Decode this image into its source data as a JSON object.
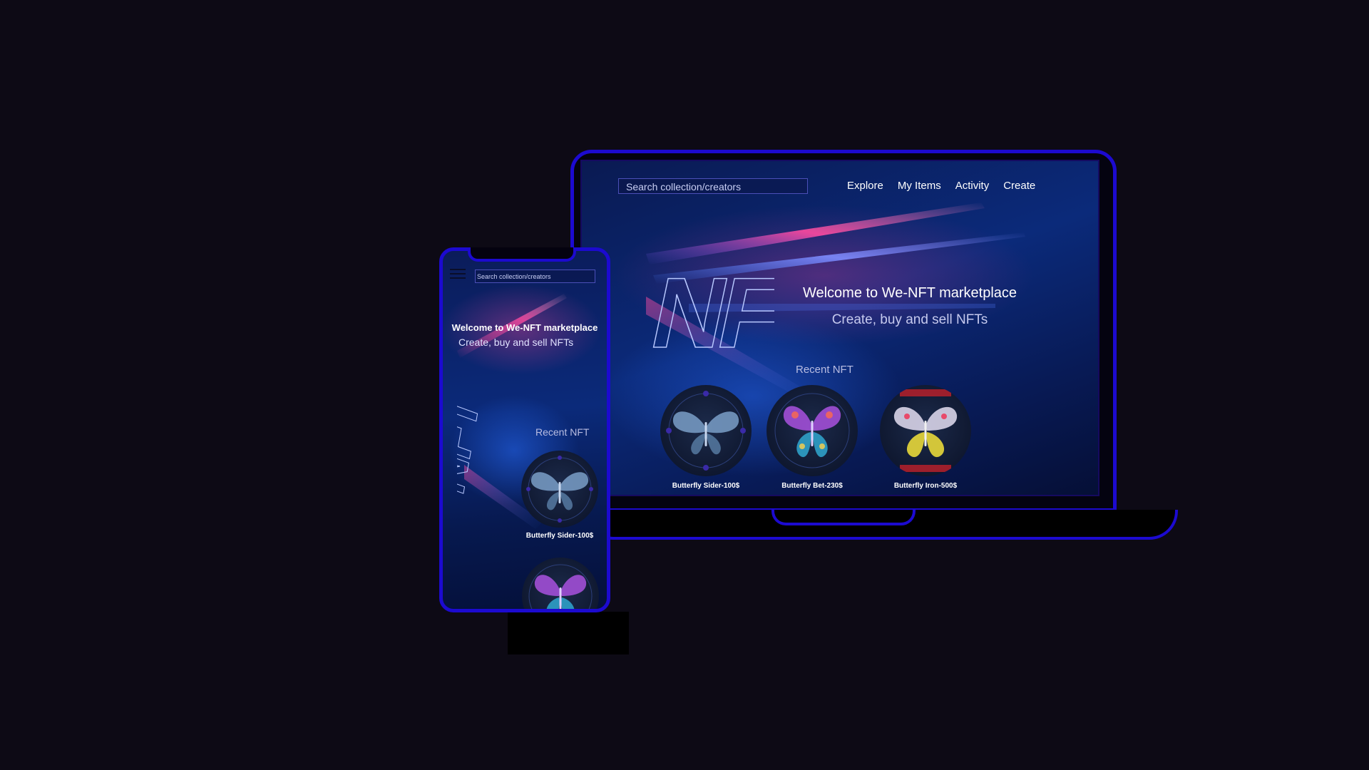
{
  "laptop": {
    "search": {
      "placeholder": "Search collection/creators"
    },
    "nav": [
      {
        "label": "Explore"
      },
      {
        "label": "My Items"
      },
      {
        "label": "Activity"
      },
      {
        "label": "Create"
      }
    ],
    "hero": {
      "logo_text": "NFT",
      "title": "Welcome to We-NFT marketplace",
      "subtitle": "Create, buy and sell NFTs"
    },
    "recent": {
      "heading": "Recent NFT",
      "items": [
        {
          "caption": "Butterfly Sider-100$",
          "icon": "butterfly-blue-icon"
        },
        {
          "caption": "Butterfly Bet-230$",
          "icon": "butterfly-rainbow-icon"
        },
        {
          "caption": "Butterfly Iron-500$",
          "icon": "butterfly-yellow-icon"
        }
      ]
    }
  },
  "phone": {
    "menu_icon": "hamburger-menu-icon",
    "search": {
      "placeholder": "Search collection/creators"
    },
    "hero": {
      "logo_text": "NFT",
      "title": "Welcome to We-NFT marketplace",
      "subtitle": "Create, buy and sell NFTs"
    },
    "recent": {
      "heading": "Recent NFT",
      "items": [
        {
          "caption": "Butterfly Sider-100$",
          "icon": "butterfly-blue-icon"
        },
        {
          "caption": "",
          "icon": "butterfly-rainbow-icon"
        }
      ]
    }
  },
  "colors": {
    "background": "#0d0a15",
    "device_border": "#1c0ad0",
    "screen_blue": "#0b2a7a",
    "accent_pink": "#ff4aa0"
  }
}
